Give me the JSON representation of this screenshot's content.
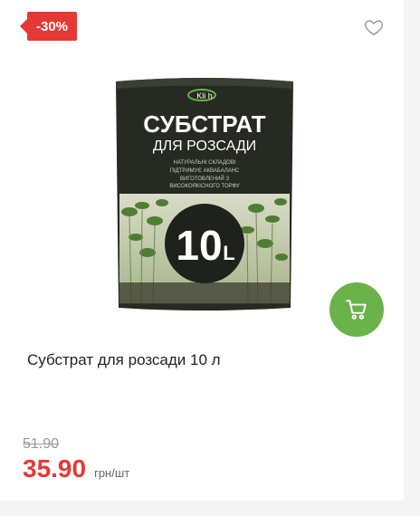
{
  "product": {
    "discount_badge": "-30%",
    "title": "Субстрат для розсади 10 л",
    "old_price": "51.90",
    "new_price": "35.90",
    "unit": "грн/шт"
  },
  "package": {
    "brand": "Kli h",
    "heading": "СУБСТРАТ",
    "subheading": "ДЛЯ РОЗСАДИ",
    "features": [
      "НАТУРАЛЬНІ СКЛАДОВІ",
      "ПІДТРИМУЄ АКВАБАЛАНС",
      "ВИГОТОВЛЕНИЙ З",
      "ВИСОКОЯКІСНОГО ТОРФУ"
    ],
    "volume": "10",
    "volume_unit": "L"
  },
  "icons": {
    "favorite": "heart-icon",
    "cart": "cart-icon"
  },
  "colors": {
    "accent_red": "#e53935",
    "cart_green": "#6ab24a"
  }
}
